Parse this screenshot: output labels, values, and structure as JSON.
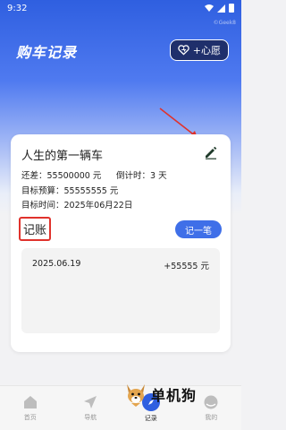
{
  "status_bar": {
    "time": "9:32"
  },
  "watermark": "©Geek8",
  "header": {
    "title": "购车记录",
    "wish_button_label": "+心愿"
  },
  "card": {
    "car_title": "人生的第一辆车",
    "difference": "还差：55500000 元",
    "countdown": "倒计时：3 天",
    "target_budget": "目标预算：55555555 元",
    "target_time": "目标时间：2025年06月22日",
    "ledger_label": "记账",
    "record_button": "记一笔",
    "records": [
      {
        "date": "2025.06.19",
        "amount": "+55555 元"
      }
    ]
  },
  "bottom_nav": {
    "items": [
      {
        "label": "首页"
      },
      {
        "label": "导航"
      },
      {
        "label": "记录"
      },
      {
        "label": "我的"
      }
    ]
  },
  "logo_overlay": {
    "text": "单机狗"
  },
  "colors": {
    "primary": "#2f5fe0",
    "highlight": "#e0322c",
    "arrow": "#e0322c"
  }
}
